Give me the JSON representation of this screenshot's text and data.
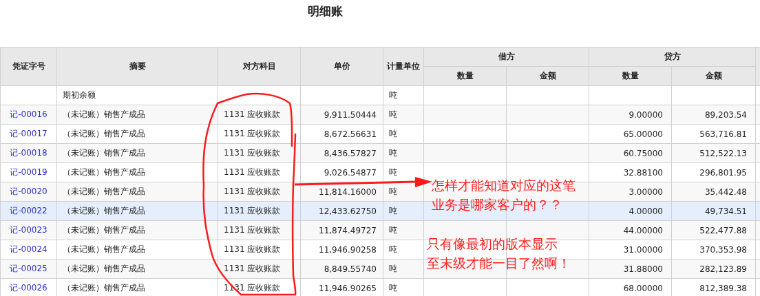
{
  "title": "明细账",
  "table": {
    "columns": [
      "凭证字号",
      "摘要",
      "对方科目",
      "单价",
      "计量单位"
    ],
    "column_groups": [
      {
        "label": "借方",
        "columns": [
          "数量",
          "金额"
        ]
      },
      {
        "label": "贷方",
        "columns": [
          "数量",
          "金额"
        ]
      }
    ],
    "rows": [
      {
        "summary": "期初余额",
        "unit": "吨",
        "selected": false
      },
      {
        "voucher": "记-00016",
        "summary": "（未记账）销售产成品",
        "account": "1131 应收账款",
        "unit_price": "9,911.50444",
        "unit": "吨",
        "credit_qty": "9.00000",
        "credit_amount": "89,203.54",
        "selected": false
      },
      {
        "voucher": "记-00017",
        "summary": "（未记账）销售产成品",
        "account": "1131 应收账款",
        "unit_price": "8,672.56631",
        "unit": "吨",
        "credit_qty": "65.00000",
        "credit_amount": "563,716.81",
        "selected": false
      },
      {
        "voucher": "记-00018",
        "summary": "（未记账）销售产成品",
        "account": "1131 应收账款",
        "unit_price": "8,436.57827",
        "unit": "吨",
        "credit_qty": "60.75000",
        "credit_amount": "512,522.13",
        "selected": false
      },
      {
        "voucher": "记-00019",
        "summary": "（未记账）销售产成品",
        "account": "1131 应收账款",
        "unit_price": "9,026.54877",
        "unit": "吨",
        "credit_qty": "32.88100",
        "credit_amount": "296,801.95",
        "selected": false
      },
      {
        "voucher": "记-00020",
        "summary": "（未记账）销售产成品",
        "account": "1131 应收账款",
        "unit_price": "11,814.16000",
        "unit": "吨",
        "credit_qty": "3.00000",
        "credit_amount": "35,442.48",
        "selected": false
      },
      {
        "voucher": "记-00022",
        "summary": "（未记账）销售产成品",
        "account": "1131 应收账款",
        "unit_price": "12,433.62750",
        "unit": "吨",
        "credit_qty": "4.00000",
        "credit_amount": "49,734.51",
        "selected": true
      },
      {
        "voucher": "记-00023",
        "summary": "（未记账）销售产成品",
        "account": "1131 应收账款",
        "unit_price": "11,874.49727",
        "unit": "吨",
        "credit_qty": "44.00000",
        "credit_amount": "522,477.88",
        "selected": false
      },
      {
        "voucher": "记-00024",
        "summary": "（未记账）销售产成品",
        "account": "1131 应收账款",
        "unit_price": "11,946.90258",
        "unit": "吨",
        "credit_qty": "31.00000",
        "credit_amount": "370,353.98",
        "selected": false
      },
      {
        "voucher": "记-00025",
        "summary": "（未记账）销售产成品",
        "account": "1131 应收账款",
        "unit_price": "8,849.55740",
        "unit": "吨",
        "credit_qty": "31.88000",
        "credit_amount": "282,123.89",
        "selected": false
      },
      {
        "voucher": "记-00026",
        "summary": "（未记账）销售产成品",
        "account": "1131 应收账款",
        "unit_price": "11,946.90265",
        "unit": "吨",
        "credit_qty": "68.00000",
        "credit_amount": "812,389.38",
        "selected": false
      }
    ]
  },
  "annotations": [
    {
      "lines": [
        "怎样才能知道对应的这笔",
        "业务是哪家客户的？？"
      ]
    },
    {
      "lines": [
        "只有像最初的版本显示",
        "至末级才能一目了然啊！"
      ]
    }
  ]
}
